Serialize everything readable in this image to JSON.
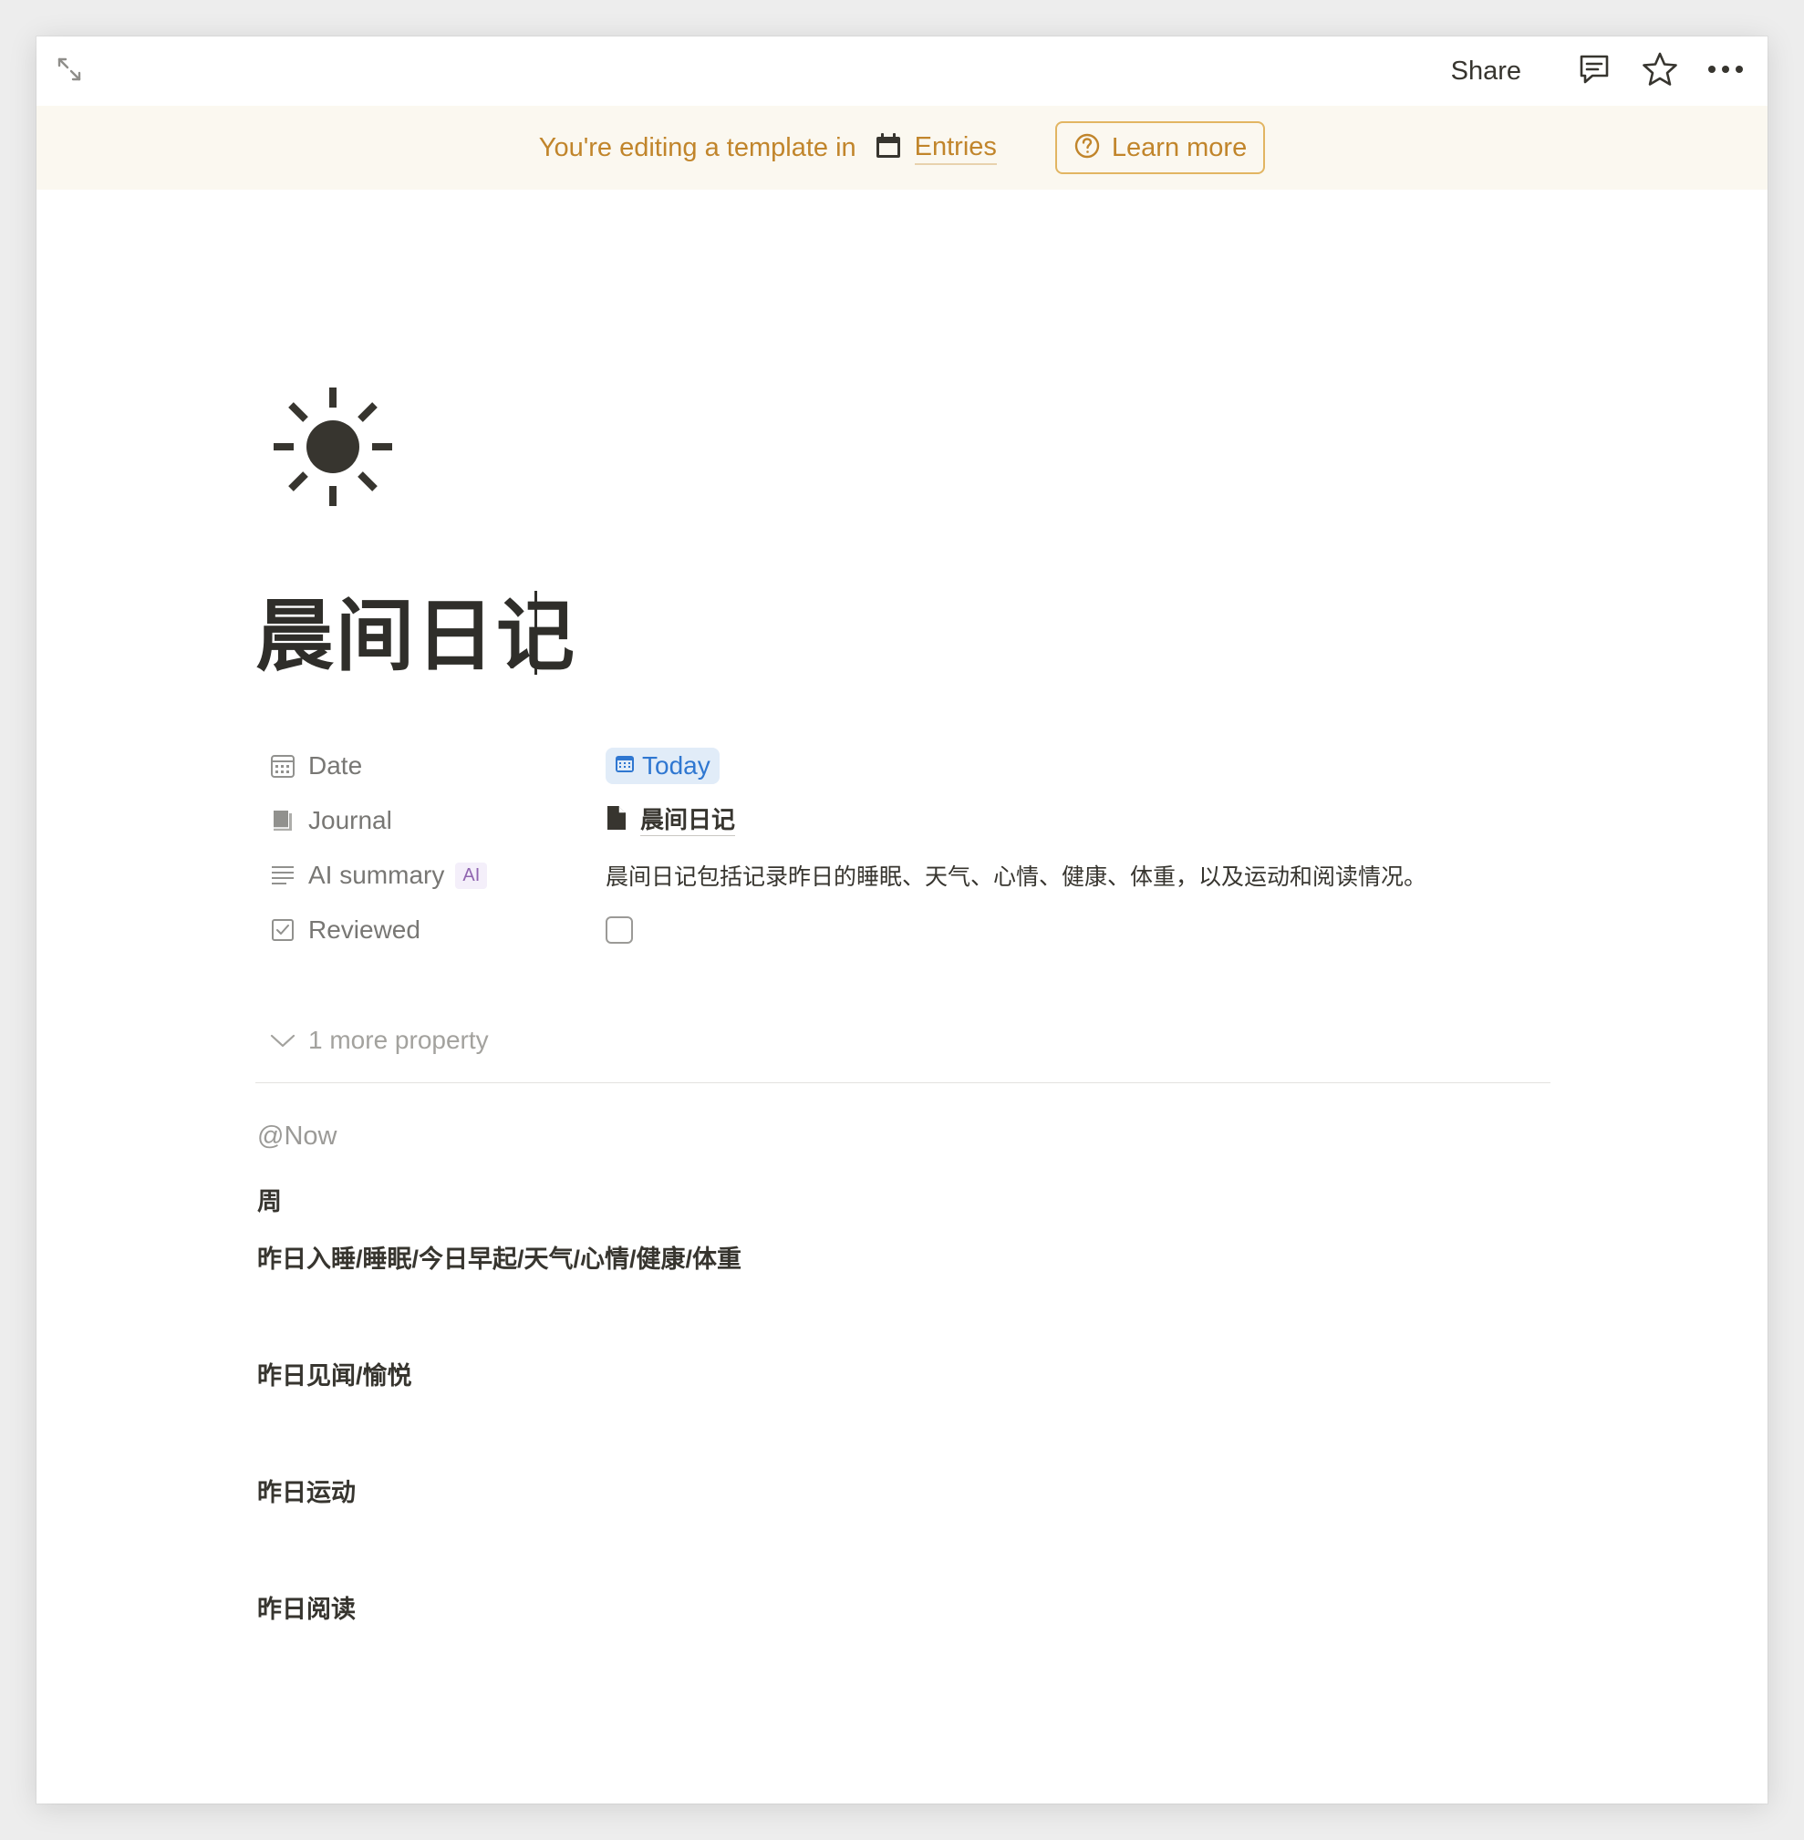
{
  "topbar": {
    "share_label": "Share"
  },
  "banner": {
    "text": "You're editing a template in",
    "database_name": "Entries",
    "learn_more_label": "Learn more",
    "accent_color": "#c1852b"
  },
  "page": {
    "icon": "sun-icon",
    "title": "晨间日记"
  },
  "properties": [
    {
      "name": "Date",
      "icon": "calendar-icon",
      "value": "Today"
    },
    {
      "name": "Journal",
      "icon": "book-icon",
      "value": "晨间日记"
    },
    {
      "name": "AI summary",
      "icon": "lines-icon",
      "badge": "AI",
      "value": "晨间日记包括记录昨日的睡眠、天气、心情、健康、体重，以及运动和阅读情况。"
    },
    {
      "name": "Reviewed",
      "icon": "checkbox-icon",
      "value": false
    }
  ],
  "more_properties_label": "1 more property",
  "content": {
    "mention": "@Now",
    "headings": [
      "周",
      "昨日入睡/睡眠/今日早起/天气/心情/健康/体重",
      "昨日见闻/愉悦",
      "昨日运动",
      "昨日阅读"
    ]
  },
  "colors": {
    "date_chip_bg": "#e1ecf8",
    "date_chip_text": "#2f77d1",
    "ai_badge": "#9065b0",
    "banner_bg": "#fbf8f0"
  }
}
